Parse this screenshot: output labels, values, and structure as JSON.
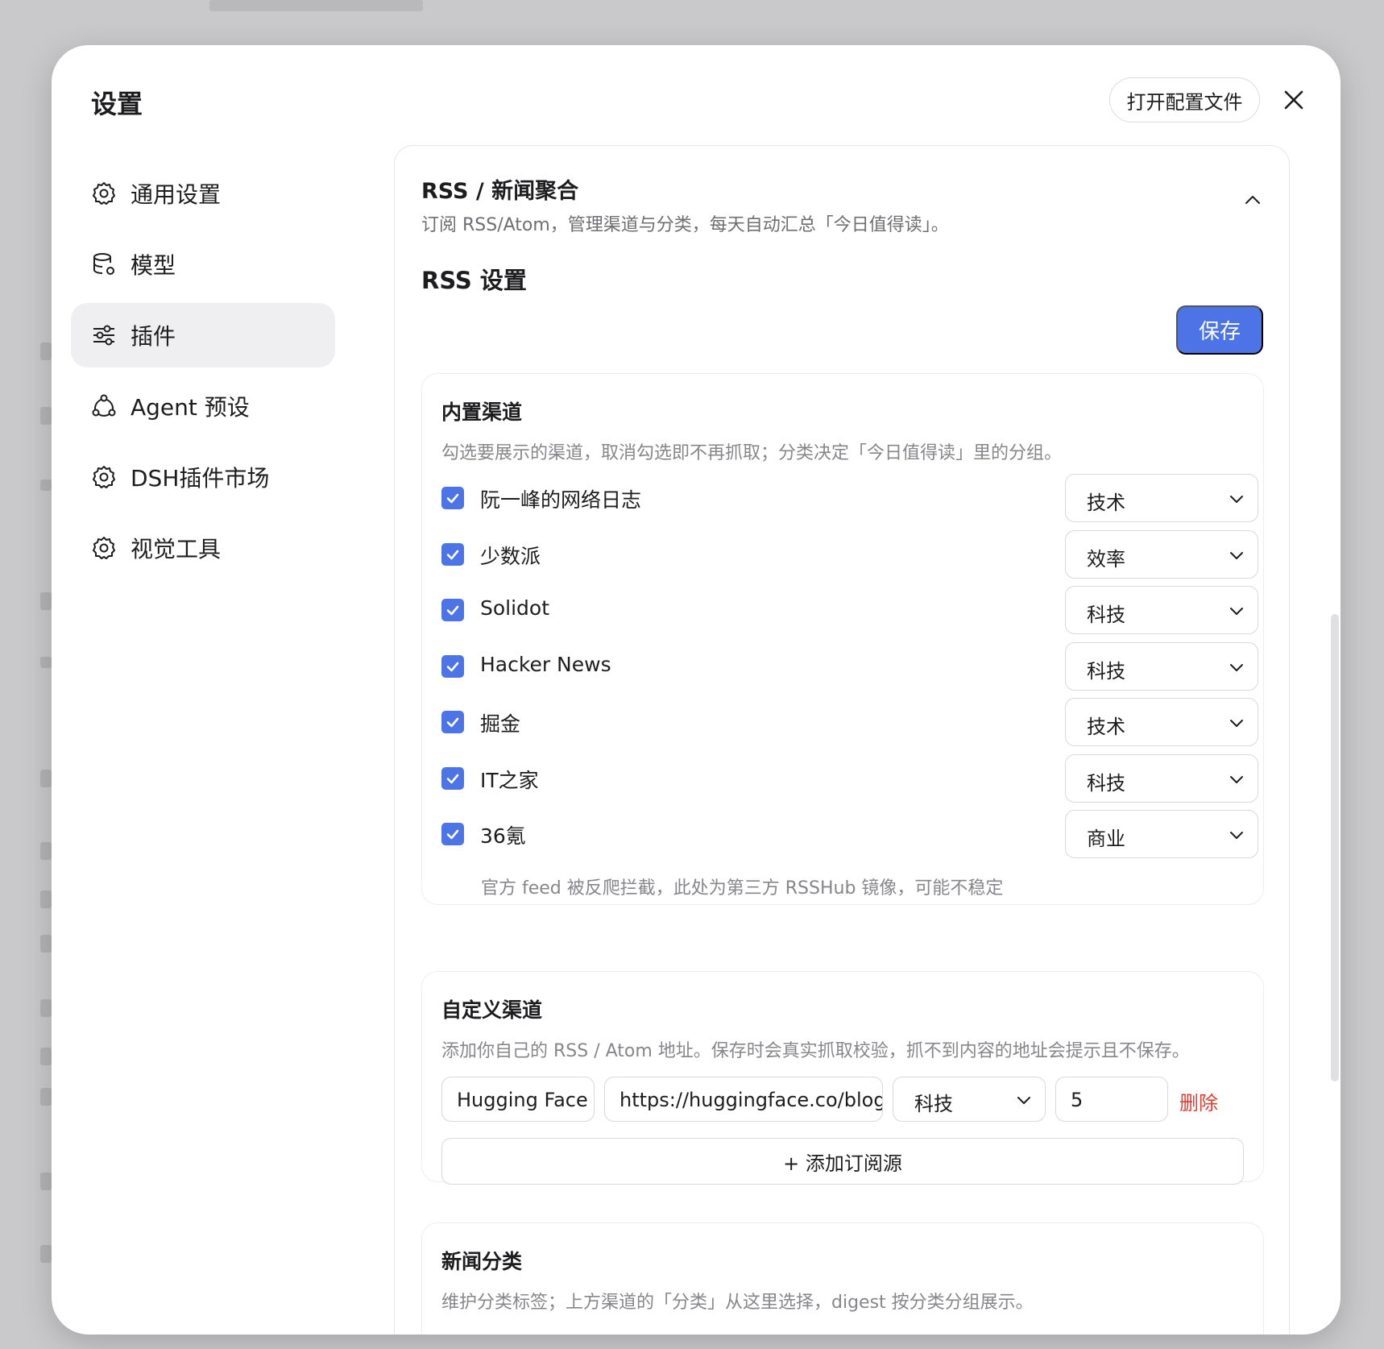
{
  "window": {
    "title": "设置",
    "open_config_label": "打开配置文件"
  },
  "sidebar": {
    "items": [
      {
        "label": "通用设置",
        "icon": "gear-icon"
      },
      {
        "label": "模型",
        "icon": "database-gear-icon"
      },
      {
        "label": "插件",
        "icon": "sliders-icon",
        "active": true
      },
      {
        "label": "Agent 预设",
        "icon": "agent-icon"
      },
      {
        "label": "DSH插件市场",
        "icon": "gear-icon"
      },
      {
        "label": "视觉工具",
        "icon": "gear-icon"
      }
    ]
  },
  "plugin": {
    "title": "RSS / 新闻聚合",
    "description": "订阅 RSS/Atom，管理渠道与分类，每天自动汇总「今日值得读」。",
    "settings_heading": "RSS 设置",
    "save_label": "保存"
  },
  "builtin": {
    "title": "内置渠道",
    "description": "勾选要展示的渠道，取消勾选即不再抓取；分类决定「今日值得读」里的分组。",
    "channels": [
      {
        "name": "阮一峰的网络日志",
        "checked": true,
        "category": "技术"
      },
      {
        "name": "少数派",
        "checked": true,
        "category": "效率"
      },
      {
        "name": "Solidot",
        "checked": true,
        "category": "科技"
      },
      {
        "name": "Hacker News",
        "checked": true,
        "category": "科技"
      },
      {
        "name": "掘金",
        "checked": true,
        "category": "技术"
      },
      {
        "name": "IT之家",
        "checked": true,
        "category": "科技"
      },
      {
        "name": "36氪",
        "checked": true,
        "category": "商业"
      }
    ],
    "note": "官方 feed 被反爬拦截，此处为第三方 RSSHub 镜像，可能不稳定"
  },
  "custom": {
    "title": "自定义渠道",
    "description": "添加你自己的 RSS / Atom 地址。保存时会真实抓取校验，抓不到内容的地址会提示且不保存。",
    "entries": [
      {
        "name": "Hugging Face",
        "url": "https://huggingface.co/blog/feed.xml",
        "category": "科技",
        "limit": "5",
        "delete_label": "删除"
      }
    ],
    "add_label": "+ 添加订阅源"
  },
  "categories": {
    "title": "新闻分类",
    "description": "维护分类标签；上方渠道的「分类」从这里选择，digest 按分类分组展示。"
  },
  "colors": {
    "accent": "#4d74e6",
    "danger": "#e03c31",
    "active_nav_bg": "#efeff1"
  }
}
